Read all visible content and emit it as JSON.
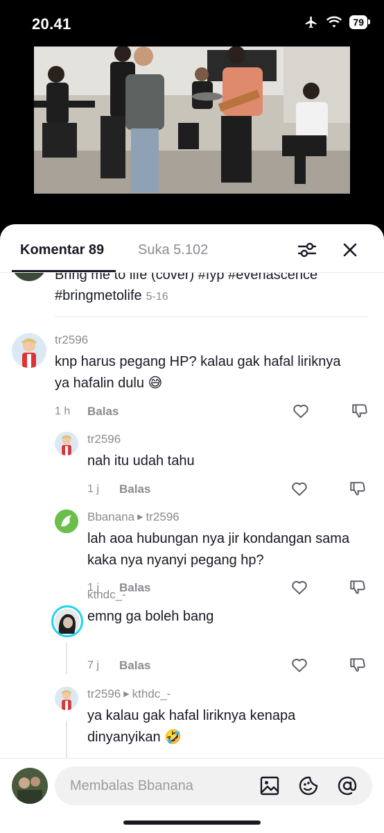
{
  "status_bar": {
    "time": "20.41",
    "battery": "79"
  },
  "tabs": {
    "comments": "Komentar 89",
    "likes": "Suka 5.102"
  },
  "caption": {
    "text": "Bring me to life (cover) #fyp #evenascence #bringmetolife",
    "date": "5-16"
  },
  "comments": [
    {
      "username": "tr2596",
      "text": "knp harus pegang HP? kalau gak hafal liriknya ya hafalin dulu 😅",
      "time": "1 h",
      "reply_label": "Balas"
    }
  ],
  "replies": [
    {
      "username": "tr2596",
      "text": "nah itu udah tahu",
      "time": "1 j",
      "reply_label": "Balas"
    },
    {
      "username": "Bbanana",
      "reply_to": "tr2596",
      "text": "lah aoa hubungan nya jir kondangan sama kaka nya nyanyi pegang hp?",
      "time": "1 j",
      "reply_label": "Balas"
    },
    {
      "username": "kthdc_-",
      "text": "emng ga boleh bang",
      "time": "7 j",
      "reply_label": "Balas"
    },
    {
      "username": "tr2596",
      "reply_to": "kthdc_-",
      "text": "ya kalau gak hafal liriknya kenapa dinyanyikan 🤣"
    }
  ],
  "input": {
    "placeholder": "Membalas Bbanana"
  },
  "icons": {
    "filter": "sliders-icon",
    "close": "close-icon",
    "like": "heart-icon",
    "dislike": "thumbs-down-icon",
    "image": "image-icon",
    "emoji": "emoji-icon",
    "mention": "at-icon"
  },
  "colors": {
    "primary_text": "#161823",
    "secondary_text": "#8a8b91",
    "accent_ring": "#20d5ec"
  }
}
